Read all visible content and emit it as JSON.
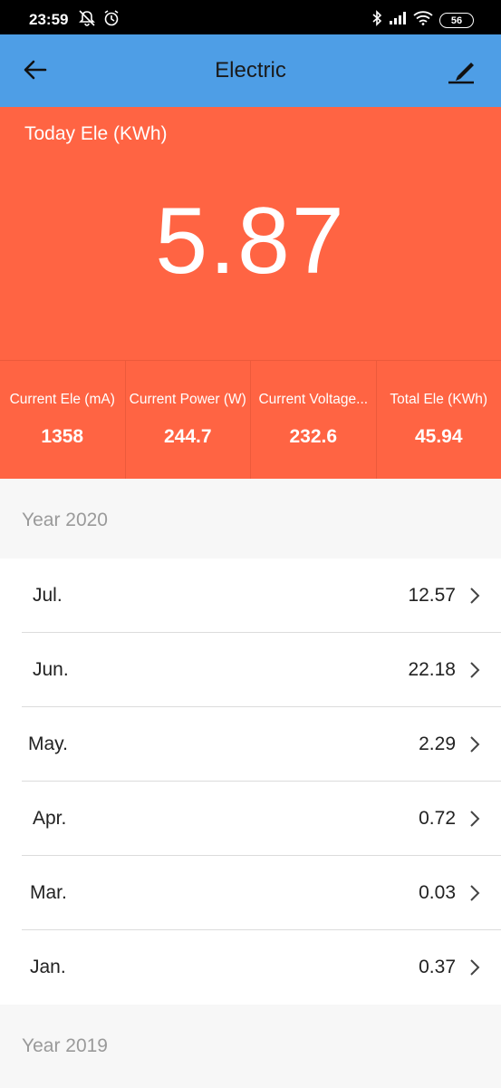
{
  "status_bar": {
    "time": "23:59",
    "battery": "56",
    "icons": [
      "notifications-off-icon",
      "alarm-icon",
      "bluetooth-icon",
      "signal-icon",
      "wifi-icon",
      "battery-icon"
    ]
  },
  "app_bar": {
    "title": "Electric",
    "back_icon": "arrow-left-icon",
    "edit_icon": "edit-pencil-icon",
    "background": "#4e9ee6"
  },
  "today": {
    "label": "Today Ele (KWh)",
    "value": "5.87",
    "background": "#ff6443"
  },
  "stats": [
    {
      "label": "Current Ele (mA)",
      "value": "1358"
    },
    {
      "label": "Current Power (W)",
      "value": "244.7"
    },
    {
      "label": "Current Voltage...",
      "value": "232.6"
    },
    {
      "label": "Total Ele (KWh)",
      "value": "45.94"
    }
  ],
  "years": [
    {
      "label": "Year 2020",
      "months": [
        {
          "name": "Jul.",
          "value": "12.57"
        },
        {
          "name": "Jun.",
          "value": "22.18"
        },
        {
          "name": "May.",
          "value": "2.29"
        },
        {
          "name": "Apr.",
          "value": "0.72"
        },
        {
          "name": "Mar.",
          "value": "0.03"
        },
        {
          "name": "Jan.",
          "value": "0.37"
        }
      ]
    },
    {
      "label": "Year 2019",
      "months": []
    }
  ]
}
